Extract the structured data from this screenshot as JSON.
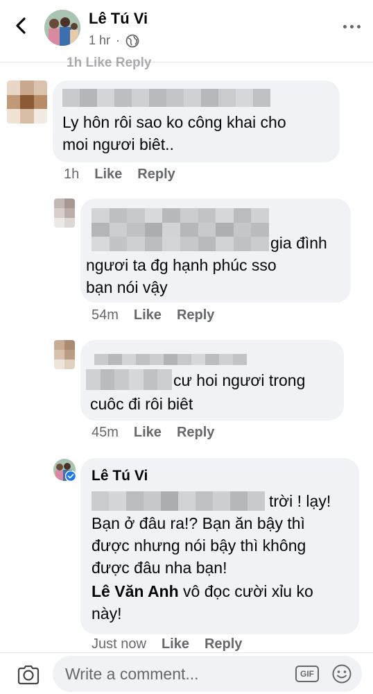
{
  "header": {
    "name": "Lê Tú Vi",
    "time": "1 hr",
    "dot": "·",
    "cutoff_text": "1h   Like   Reply"
  },
  "comments": [
    {
      "text": "Ly hôn rôi sao ko công khai cho\nmoi ngươi biêt..",
      "time": "1h",
      "like": "Like",
      "reply": "Reply"
    },
    {
      "text_tail": "gia đình",
      "text_rest": "ngươi ta đg hạnh phúc sso\nbạn nói vậy",
      "time": "54m",
      "like": "Like",
      "reply": "Reply"
    },
    {
      "text_tail": "cư hoi ngươi trong",
      "text_rest": "cuôc đi rôi biêt",
      "time": "45m",
      "like": "Like",
      "reply": "Reply"
    },
    {
      "author": "Lê Tú Vi",
      "text_tail": "trời ! lạy!",
      "text_rest": "Bạn ở đâu ra!? Bạn ăn bậy thì\nđược nhưng nói bậy thì không\nđược đâu nha bạn!",
      "mention": "Lê Văn Anh",
      "mention_tail": " vô đọc cười xỉu ko",
      "last_line": "này!",
      "time": "Just now",
      "like": "Like",
      "reply": "Reply"
    }
  ],
  "composer": {
    "placeholder": "Write a comment...",
    "gif_label": "GIF"
  },
  "icons": {
    "back": "chevron-left-icon",
    "globe": "globe-icon",
    "more": "more-horizontal-icon",
    "camera": "camera-icon",
    "emoji": "smile-icon",
    "verified": "verified-badge-icon"
  }
}
